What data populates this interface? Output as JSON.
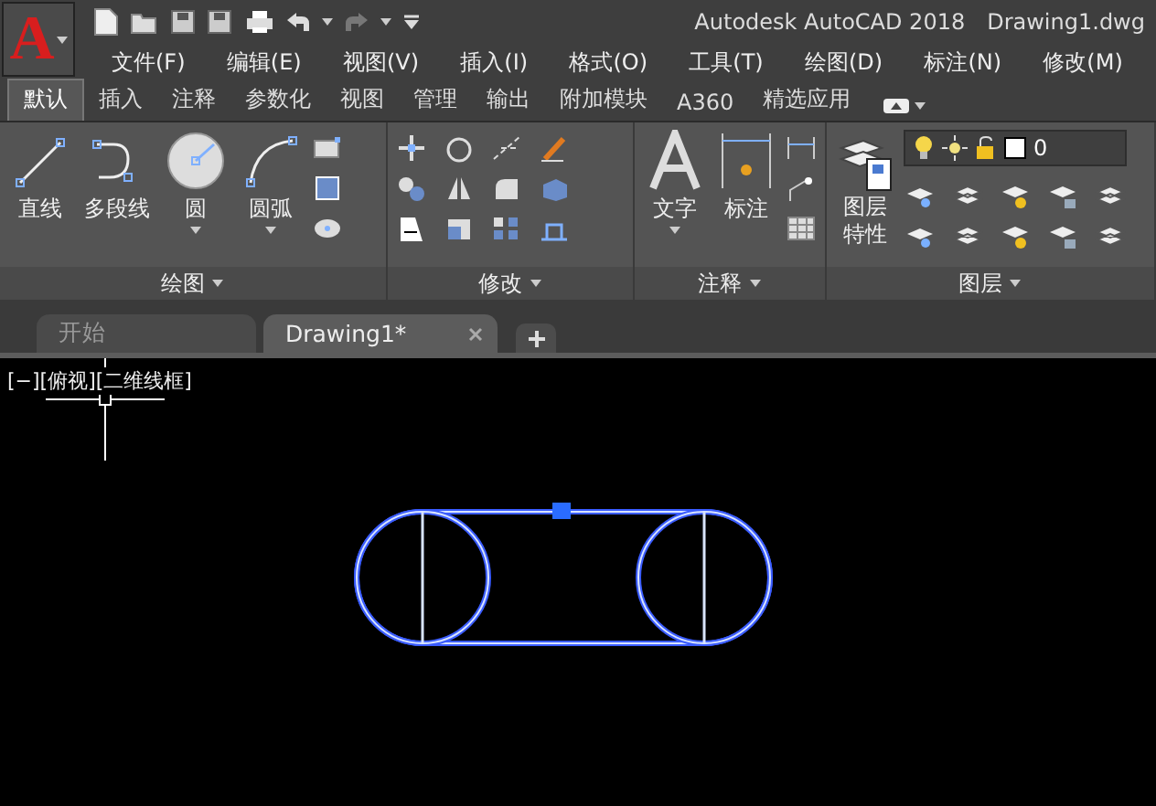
{
  "logo": {
    "letter": "A"
  },
  "window": {
    "title": "Autodesk AutoCAD 2018",
    "file_name": "Drawing1.dwg"
  },
  "menu": [
    "文件(F)",
    "编辑(E)",
    "视图(V)",
    "插入(I)",
    "格式(O)",
    "工具(T)",
    "绘图(D)",
    "标注(N)",
    "修改(M)"
  ],
  "ribbon_tabs": [
    {
      "label": "默认",
      "selected": true
    },
    {
      "label": "插入",
      "selected": false
    },
    {
      "label": "注释",
      "selected": false
    },
    {
      "label": "参数化",
      "selected": false
    },
    {
      "label": "视图",
      "selected": false
    },
    {
      "label": "管理",
      "selected": false
    },
    {
      "label": "输出",
      "selected": false
    },
    {
      "label": "附加模块",
      "selected": false
    },
    {
      "label": "A360",
      "selected": false
    },
    {
      "label": "精选应用",
      "selected": false
    }
  ],
  "panels": [
    {
      "kind": "draw",
      "title": "绘图",
      "tools": [
        {
          "label": "直线",
          "kind": "line",
          "dropdown": false
        },
        {
          "label": "多段线",
          "kind": "polyline",
          "dropdown": false
        },
        {
          "label": "圆",
          "kind": "circle",
          "dropdown": true
        },
        {
          "label": "圆弧",
          "kind": "arc",
          "dropdown": true
        }
      ]
    },
    {
      "kind": "modify",
      "title": "修改"
    },
    {
      "kind": "annotate",
      "title": "注释",
      "tools": [
        {
          "label": "文字",
          "kind": "text",
          "dropdown": true
        },
        {
          "label": "标注",
          "kind": "dimension",
          "dropdown": false
        }
      ]
    },
    {
      "kind": "layers",
      "title": "图层",
      "tools": [
        {
          "label": "图层特性",
          "kind": "layer-properties",
          "dropdown": false
        }
      ],
      "layer_value": "0"
    }
  ],
  "doc_tabs": [
    {
      "label": "开始",
      "selected": false,
      "closable": false
    },
    {
      "label": "Drawing1*",
      "selected": true,
      "closable": true
    }
  ],
  "viewport": {
    "label": "[−][俯视][二维线框]"
  }
}
